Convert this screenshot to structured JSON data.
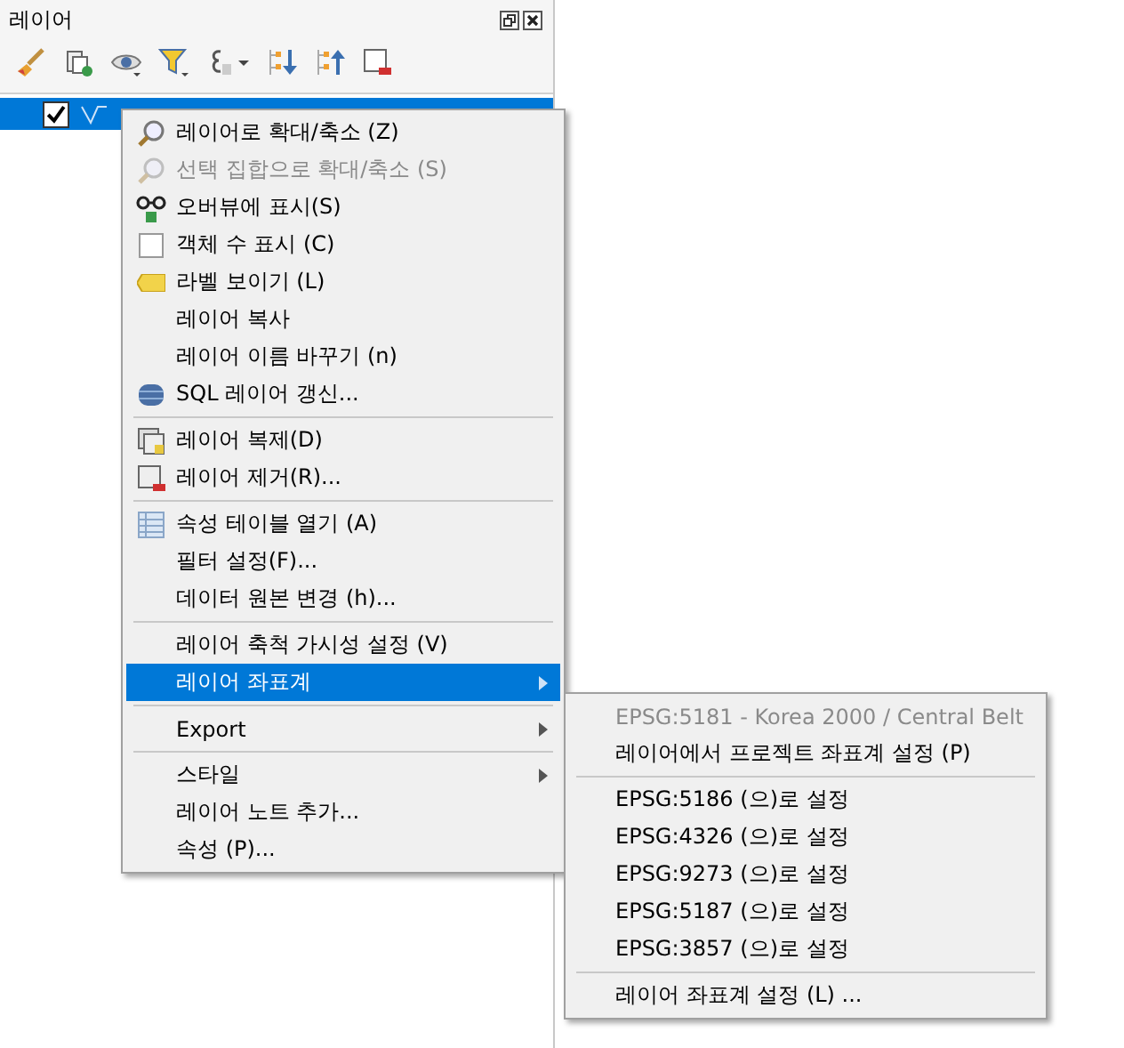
{
  "panel": {
    "title": "레이어",
    "layers": [
      {
        "checked": true,
        "selected": true
      }
    ]
  },
  "menu": {
    "items": [
      {
        "kind": "item",
        "label": "레이어로 확대/축소 (Z)",
        "disabled": false,
        "selected": false,
        "submenu": false
      },
      {
        "kind": "item",
        "label": "선택 집합으로 확대/축소 (S)",
        "disabled": true,
        "selected": false,
        "submenu": false
      },
      {
        "kind": "item",
        "label": "오버뷰에 표시(S)",
        "disabled": false,
        "selected": false,
        "submenu": false
      },
      {
        "kind": "checkbox",
        "label": "객체 수 표시 (C)",
        "checked": false,
        "disabled": false,
        "selected": false,
        "submenu": false
      },
      {
        "kind": "item",
        "label": "라벨 보이기 (L)",
        "disabled": false,
        "selected": false,
        "submenu": false
      },
      {
        "kind": "item",
        "label": "레이어 복사",
        "disabled": false,
        "selected": false,
        "submenu": false
      },
      {
        "kind": "item",
        "label": "레이어 이름 바꾸기 (n)",
        "disabled": false,
        "selected": false,
        "submenu": false
      },
      {
        "kind": "item",
        "label": "SQL 레이어 갱신...",
        "disabled": false,
        "selected": false,
        "submenu": false
      },
      {
        "kind": "separator"
      },
      {
        "kind": "item",
        "label": "레이어 복제(D)",
        "disabled": false,
        "selected": false,
        "submenu": false
      },
      {
        "kind": "item",
        "label": "레이어 제거(R)...",
        "disabled": false,
        "selected": false,
        "submenu": false
      },
      {
        "kind": "separator"
      },
      {
        "kind": "item",
        "label": "속성 테이블 열기 (A)",
        "disabled": false,
        "selected": false,
        "submenu": false
      },
      {
        "kind": "item",
        "label": "필터 설정(F)...",
        "disabled": false,
        "selected": false,
        "submenu": false
      },
      {
        "kind": "item",
        "label": "데이터 원본 변경 (h)...",
        "disabled": false,
        "selected": false,
        "submenu": false
      },
      {
        "kind": "separator"
      },
      {
        "kind": "item",
        "label": "레이어 축척 가시성 설정 (V)",
        "disabled": false,
        "selected": false,
        "submenu": false
      },
      {
        "kind": "item",
        "label": "레이어 좌표계",
        "disabled": false,
        "selected": true,
        "submenu": true
      },
      {
        "kind": "separator"
      },
      {
        "kind": "item",
        "label": "Export",
        "disabled": false,
        "selected": false,
        "submenu": true
      },
      {
        "kind": "separator"
      },
      {
        "kind": "item",
        "label": "스타일",
        "disabled": false,
        "selected": false,
        "submenu": true
      },
      {
        "kind": "item",
        "label": "레이어 노트 추가...",
        "disabled": false,
        "selected": false,
        "submenu": false
      },
      {
        "kind": "item",
        "label": "속성 (P)...",
        "disabled": false,
        "selected": false,
        "submenu": false
      }
    ]
  },
  "submenu": {
    "items": [
      {
        "kind": "item",
        "label": "EPSG:5181 - Korea 2000 / Central Belt",
        "disabled": true
      },
      {
        "kind": "item",
        "label": "레이어에서 프로젝트 좌표계 설정 (P)",
        "disabled": false
      },
      {
        "kind": "separator"
      },
      {
        "kind": "item",
        "label": "EPSG:5186 (으)로 설정",
        "disabled": false
      },
      {
        "kind": "item",
        "label": "EPSG:4326 (으)로 설정",
        "disabled": false
      },
      {
        "kind": "item",
        "label": "EPSG:9273 (으)로 설정",
        "disabled": false
      },
      {
        "kind": "item",
        "label": "EPSG:5187 (으)로 설정",
        "disabled": false
      },
      {
        "kind": "item",
        "label": "EPSG:3857 (으)로 설정",
        "disabled": false
      },
      {
        "kind": "separator"
      },
      {
        "kind": "item",
        "label": "레이어 좌표계 설정 (L) ...",
        "disabled": false
      }
    ]
  }
}
